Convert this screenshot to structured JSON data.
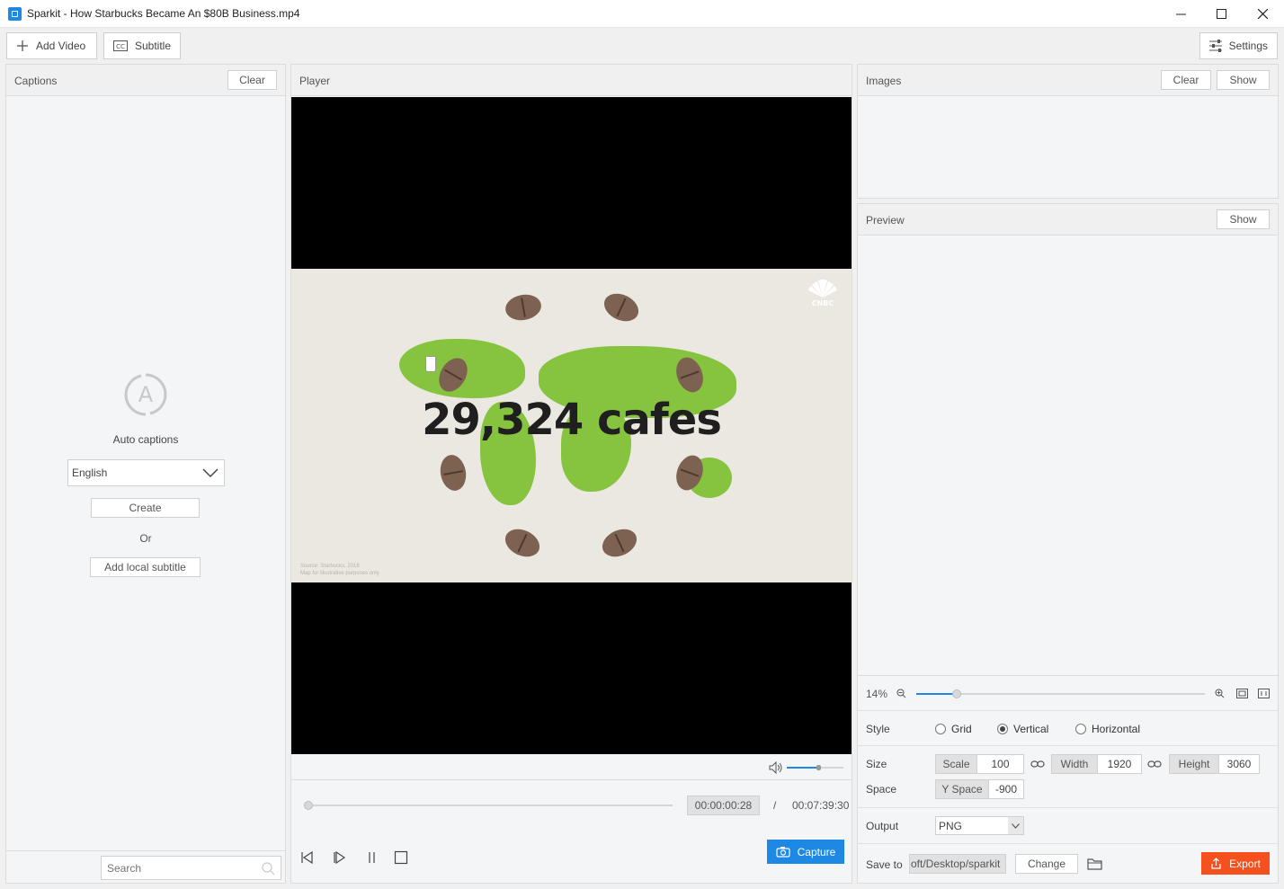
{
  "window": {
    "title": "Sparkit - How Starbucks Became An $80B Business.mp4"
  },
  "toolbar": {
    "add_video": "Add Video",
    "subtitle": "Subtitle",
    "settings": "Settings"
  },
  "captions": {
    "title": "Captions",
    "clear": "Clear",
    "auto_captions": "Auto captions",
    "language": "English",
    "create": "Create",
    "or": "Or",
    "add_local": "Add local subtitle",
    "search_placeholder": "Search"
  },
  "player": {
    "title": "Player",
    "overlay_text": "29,324 cafes",
    "brand_mark": "CNBC",
    "source_line1": "Source: Starbucks, 2018",
    "source_line2": "Map for illustrative purposes only",
    "current_time": "00:00:00:28",
    "separator": "/",
    "total_time": "00:07:39:30",
    "capture": "Capture",
    "progress": 0.0,
    "volume": 0.55
  },
  "images": {
    "title": "Images",
    "clear": "Clear",
    "show": "Show"
  },
  "preview": {
    "title": "Preview",
    "show": "Show",
    "zoom": "14%",
    "zoom_level": 0.14
  },
  "settings": {
    "style_label": "Style",
    "style_options": [
      "Grid",
      "Vertical",
      "Horizontal"
    ],
    "style_selected": "Vertical",
    "size_label": "Size",
    "scale_label": "Scale",
    "scale_value": "100",
    "width_label": "Width",
    "width_value": "1920",
    "height_label": "Height",
    "height_value": "3060",
    "space_label": "Space",
    "yspace_label": "Y Space",
    "yspace_value": "-900",
    "output_label": "Output",
    "output_value": "PNG",
    "saveto_label": "Save to",
    "saveto_value": "oft/Desktop/sparkit",
    "change": "Change",
    "export": "Export"
  },
  "colors": {
    "accent": "#1e88e5",
    "export": "#f4511e",
    "map_green": "#86c440"
  }
}
